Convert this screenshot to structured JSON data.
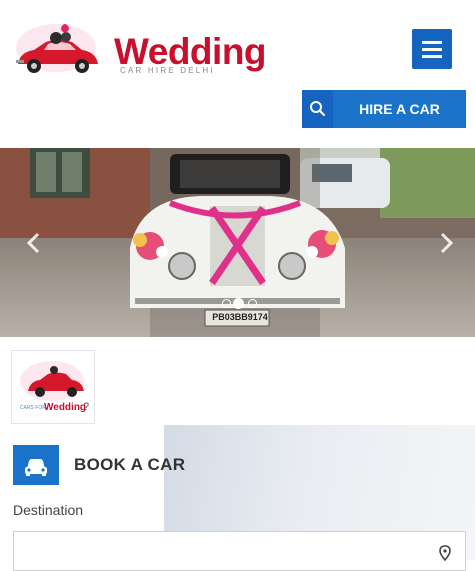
{
  "header": {
    "logo_word": "Wedding",
    "logo_sub": "CAR HIRE DELHI",
    "hire_label": "HIRE A CAR"
  },
  "carousel": {
    "plate_text": "PB03BB9174",
    "slide_count": 3,
    "active_slide": 2
  },
  "thumb": {
    "small_text": "CARS FOR",
    "main_text": "Wedding",
    "mark": "?"
  },
  "booking": {
    "title": "BOOK A CAR",
    "destination_label": "Destination",
    "destination_value": "",
    "destination_placeholder": ""
  },
  "colors": {
    "brand_red": "#c8102e",
    "primary_blue": "#1a73c9",
    "dark_blue": "#1565c0"
  },
  "icons": [
    "menu-icon",
    "search-icon",
    "chevron-left-icon",
    "chevron-right-icon",
    "car-icon",
    "location-pin-icon"
  ]
}
